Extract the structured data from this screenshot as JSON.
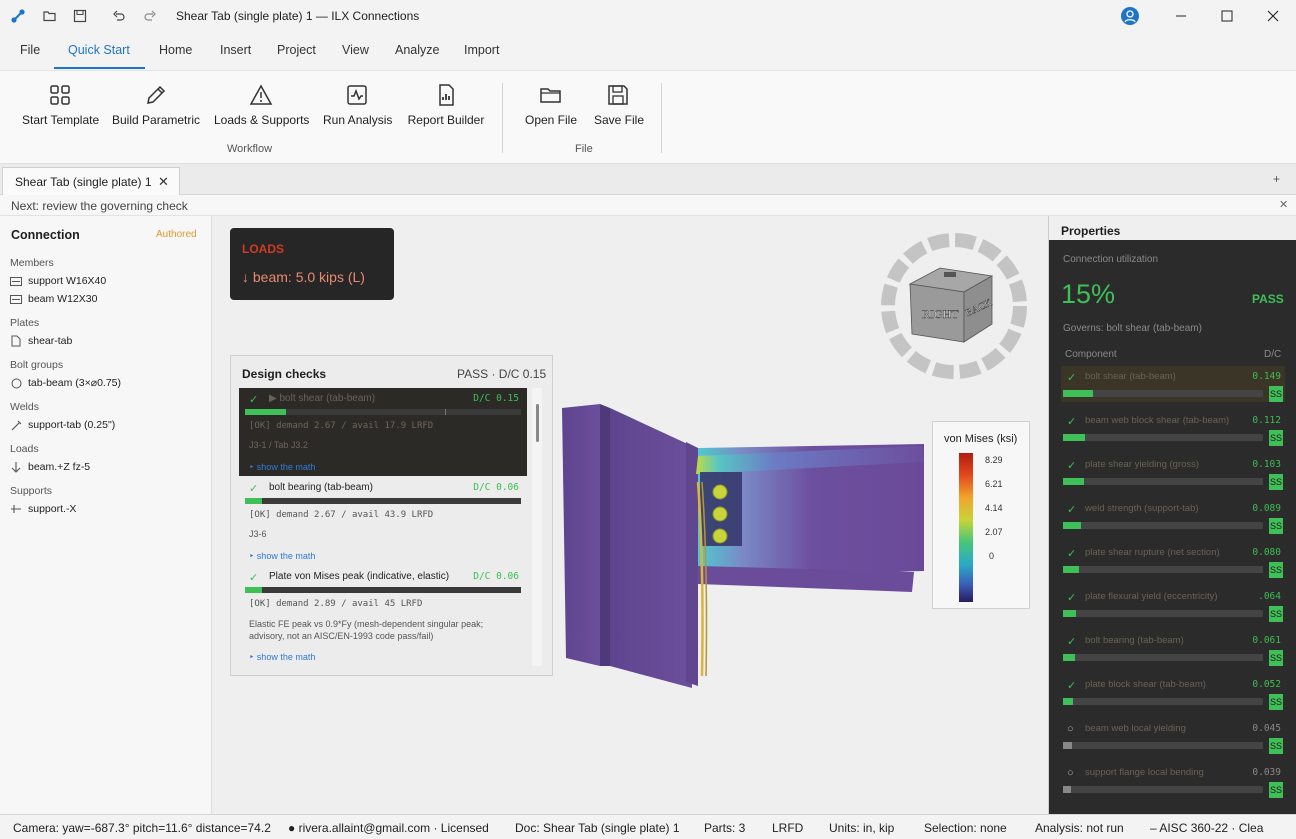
{
  "window": {
    "title": "Shear Tab (single plate) 1 — ILX Connections"
  },
  "menu": {
    "items": [
      "File",
      "Quick Start",
      "Home",
      "Insert",
      "Project",
      "View",
      "Analyze",
      "Import"
    ],
    "active": "Quick Start"
  },
  "ribbon": {
    "workflow": [
      {
        "label": "Start Template",
        "icon": "grid-icon"
      },
      {
        "label": "Build Parametric",
        "icon": "pencil-icon"
      },
      {
        "label": "Loads & Supports",
        "icon": "warning-icon"
      },
      {
        "label": "Run Analysis",
        "icon": "pulse-icon"
      },
      {
        "label": "Report Builder",
        "icon": "report-icon"
      }
    ],
    "workflow_group": "Workflow",
    "file": [
      {
        "label": "Open File",
        "icon": "folder-icon"
      },
      {
        "label": "Save File",
        "icon": "save-icon"
      }
    ],
    "file_group": "File"
  },
  "doc_tab": {
    "label": "Shear Tab (single plate) 1",
    "close": "✕",
    "add": "+"
  },
  "hint": {
    "text": "Next: review the governing check",
    "close": "✕"
  },
  "left": {
    "title": "Connection",
    "status": "Authored",
    "sections": [
      {
        "heading": "Members",
        "items": [
          {
            "icon": "member-icon",
            "label": "support  W16X40"
          },
          {
            "icon": "member-icon",
            "label": "beam  W12X30"
          }
        ]
      },
      {
        "heading": "Plates",
        "items": [
          {
            "icon": "plate-icon",
            "label": "shear-tab"
          }
        ]
      },
      {
        "heading": "Bolt groups",
        "items": [
          {
            "icon": "bolt-icon",
            "label": "tab-beam (3×⌀0.75)"
          }
        ]
      },
      {
        "heading": "Welds",
        "items": [
          {
            "icon": "weld-icon",
            "label": "support-tab (0.25\")"
          }
        ]
      },
      {
        "heading": "Loads",
        "items": [
          {
            "icon": "load-arrow-icon",
            "label": "beam.+Z  fz-5"
          }
        ]
      },
      {
        "heading": "Supports",
        "items": [
          {
            "icon": "support-icon",
            "label": "support.-X"
          }
        ]
      }
    ]
  },
  "loads_box": {
    "title": "LOADS",
    "arrow": "↓",
    "text": "beam:  5.0 kips  (L)"
  },
  "design_checks": {
    "title": "Design checks",
    "summary": "PASS · D/C 0.15",
    "items": [
      {
        "mark": "✓",
        "name": "▶  bolt shear (tab-beam)",
        "dc": "D/C 0.15",
        "ratio": 0.15,
        "demand": "[OK] demand 2.67 / avail 17.9 LRFD",
        "ref": "J3-1 / Tab J3.2",
        "math": "‣ show the math",
        "selected": true
      },
      {
        "mark": "✓",
        "name": "bolt bearing (tab-beam)",
        "dc": "D/C 0.06",
        "ratio": 0.06,
        "demand": "[OK] demand 2.67 / avail 43.9 LRFD",
        "ref": "J3-6",
        "math": "‣ show the math",
        "selected": false
      },
      {
        "mark": "✓",
        "name": "Plate von Mises peak (indicative, elastic)",
        "dc": "D/C 0.06",
        "ratio": 0.06,
        "demand": "[OK] demand 2.89 / avail 45 LRFD",
        "ref": "Elastic FE peak vs 0.9*Fy (mesh-dependent singular peak; advisory, not an AISC/EN-1993 code pass/fail)",
        "math": "‣ show the math",
        "selected": false
      }
    ]
  },
  "viewcube": {
    "right": "RIGHT",
    "back": "BACK"
  },
  "legend": {
    "title": "von Mises (ksi)",
    "ticks": [
      "8.29",
      "6.21",
      "4.14",
      "2.07",
      "0"
    ]
  },
  "properties": {
    "header": "Properties",
    "util_label": "Connection utilization",
    "util_value": "15%",
    "status": "PASS",
    "governs": "Governs: bolt shear (tab-beam)",
    "col_component": "Component",
    "col_dc": "D/C",
    "rows": [
      {
        "mark": "✓",
        "name": "bolt shear (tab-beam)",
        "value": "0.149",
        "ratio": 0.149,
        "ss": "SS",
        "selected": true,
        "pending": false
      },
      {
        "mark": "✓",
        "name": "beam web block shear (tab-beam)",
        "value": "0.112",
        "ratio": 0.112,
        "ss": "SS",
        "selected": false,
        "pending": false
      },
      {
        "mark": "✓",
        "name": "plate shear yielding (gross)",
        "value": "0.103",
        "ratio": 0.103,
        "ss": "SS",
        "selected": false,
        "pending": false
      },
      {
        "mark": "✓",
        "name": "weld strength (support-tab)",
        "value": "0.089",
        "ratio": 0.089,
        "ss": "SS",
        "selected": false,
        "pending": false
      },
      {
        "mark": "✓",
        "name": "plate shear rupture (net section)",
        "value": "0.080",
        "ratio": 0.08,
        "ss": "SS",
        "selected": false,
        "pending": false
      },
      {
        "mark": "✓",
        "name": "plate flexural yield (eccentricity)",
        "value": ".064",
        "ratio": 0.064,
        "ss": "SS",
        "selected": false,
        "pending": false
      },
      {
        "mark": "✓",
        "name": "bolt bearing (tab-beam)",
        "value": "0.061",
        "ratio": 0.061,
        "ss": "SS",
        "selected": false,
        "pending": false
      },
      {
        "mark": "✓",
        "name": "plate block shear (tab-beam)",
        "value": "0.052",
        "ratio": 0.052,
        "ss": "SS",
        "selected": false,
        "pending": false
      },
      {
        "mark": "○",
        "name": "beam web local yielding",
        "value": "0.045",
        "ratio": 0.045,
        "ss": "SS",
        "selected": false,
        "pending": true
      },
      {
        "mark": "○",
        "name": "support flange local bending",
        "value": "0.039",
        "ratio": 0.039,
        "ss": "SS",
        "selected": false,
        "pending": true
      }
    ]
  },
  "statusbar": {
    "camera": "Camera: yaw=-687.3° pitch=11.6° distance=74.2",
    "user": "● rivera.allaint@gmail.com · Licensed",
    "doc": "Doc: Shear Tab (single plate) 1",
    "parts": "Parts: 3",
    "method": "LRFD",
    "units": "Units: in, kip",
    "selection": "Selection: none",
    "analysis": "Analysis: not run",
    "code": "–  AISC 360-22  ·  Clea"
  },
  "colors": {
    "accent": "#1e74c7",
    "pass": "#3fbf58",
    "loads": "#d23a24"
  }
}
